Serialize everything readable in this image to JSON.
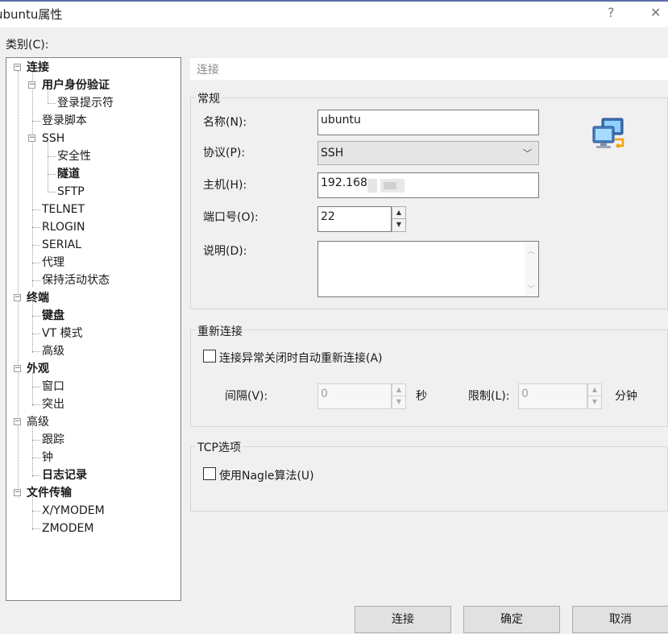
{
  "window": {
    "title": "ubuntu属性",
    "help_glyph": "?",
    "close_glyph": "✕"
  },
  "category": {
    "label": "类别(C):"
  },
  "tree": [
    {
      "label": "连接",
      "bold": true
    },
    {
      "label": "用户身份验证",
      "bold": true
    },
    {
      "label": "登录提示符",
      "bold": false
    },
    {
      "label": "登录脚本",
      "bold": false
    },
    {
      "label": "SSH",
      "bold": false
    },
    {
      "label": "安全性",
      "bold": false
    },
    {
      "label": "隧道",
      "bold": true
    },
    {
      "label": "SFTP",
      "bold": false
    },
    {
      "label": "TELNET",
      "bold": false
    },
    {
      "label": "RLOGIN",
      "bold": false
    },
    {
      "label": "SERIAL",
      "bold": false
    },
    {
      "label": "代理",
      "bold": false
    },
    {
      "label": "保持活动状态",
      "bold": false
    },
    {
      "label": "终端",
      "bold": true
    },
    {
      "label": "键盘",
      "bold": true
    },
    {
      "label": "VT 模式",
      "bold": false
    },
    {
      "label": "高级",
      "bold": false
    },
    {
      "label": "外观",
      "bold": true
    },
    {
      "label": "窗口",
      "bold": false
    },
    {
      "label": "突出",
      "bold": false
    },
    {
      "label": "高级",
      "bold": false
    },
    {
      "label": "跟踪",
      "bold": false
    },
    {
      "label": "钟",
      "bold": false
    },
    {
      "label": "日志记录",
      "bold": true
    },
    {
      "label": "文件传输",
      "bold": true
    },
    {
      "label": "X/YMODEM",
      "bold": false
    },
    {
      "label": "ZMODEM",
      "bold": false
    }
  ],
  "panel": {
    "header": "连接",
    "general": {
      "title": "常规",
      "name_label": "名称(N):",
      "name_value": "ubuntu",
      "protocol_label": "协议(P):",
      "protocol_value": "SSH",
      "host_label": "主机(H):",
      "host_value": "192.168",
      "port_label": "端口号(O):",
      "port_value": "22",
      "desc_label": "说明(D):",
      "desc_value": ""
    },
    "reconnect": {
      "title": "重新连接",
      "checkbox_label": "连接异常关闭时自动重新连接(A)",
      "interval_label": "间隔(V):",
      "interval_value": "0",
      "interval_unit": "秒",
      "limit_label": "限制(L):",
      "limit_value": "0",
      "limit_unit": "分钟"
    },
    "tcp": {
      "title": "TCP选项",
      "nagle_label": "使用Nagle算法(U)"
    }
  },
  "buttons": {
    "connect": "连接",
    "ok": "确定",
    "cancel": "取消"
  },
  "icons": {
    "connection": "network-computers-icon",
    "spin_up": "▲",
    "spin_down": "▼",
    "combo_arrow": "﹀",
    "expander": "−"
  }
}
